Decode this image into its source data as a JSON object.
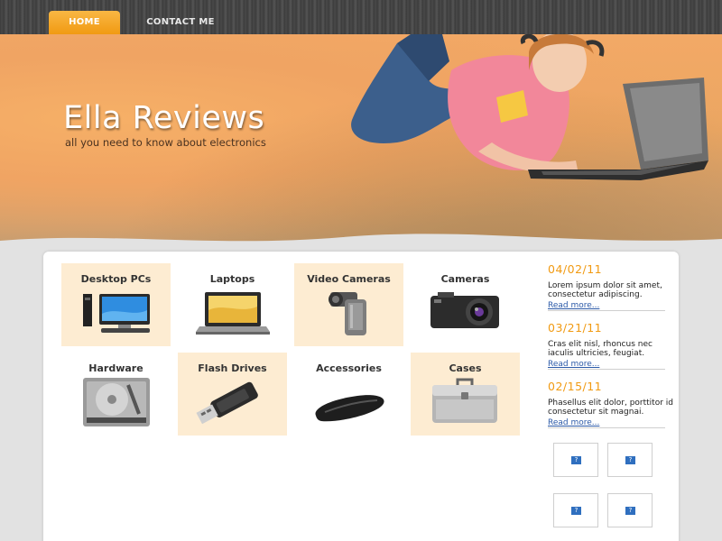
{
  "nav": {
    "home": "HOME",
    "contact": "CONTACT ME"
  },
  "hero": {
    "title": "Ella Reviews",
    "tagline": "all you need to know about electronics"
  },
  "categories": [
    {
      "label": "Desktop PCs",
      "icon": "desktop-pc-icon"
    },
    {
      "label": "Laptops",
      "icon": "laptop-icon"
    },
    {
      "label": "Video Cameras",
      "icon": "video-camera-icon"
    },
    {
      "label": "Cameras",
      "icon": "camera-icon"
    },
    {
      "label": "Hardware",
      "icon": "hard-drive-icon"
    },
    {
      "label": "Flash Drives",
      "icon": "flash-drive-icon"
    },
    {
      "label": "Accessories",
      "icon": "mouse-icon"
    },
    {
      "label": "Cases",
      "icon": "case-icon"
    }
  ],
  "news": [
    {
      "date": "04/02/11",
      "text": "Lorem ipsum dolor sit amet, consectetur adipiscing.",
      "link": "Read more..."
    },
    {
      "date": "03/21/11",
      "text": "Cras elit nisl, rhoncus nec iaculis ultricies, feugiat.",
      "link": "Read more..."
    },
    {
      "date": "02/15/11",
      "text": "Phasellus elit dolor, porttitor id consectetur sit magnai.",
      "link": "Read more..."
    }
  ],
  "thumbs": [
    "?",
    "?",
    "?",
    "?"
  ],
  "colors": {
    "accent": "#f19a12",
    "tile_shade": "#fdecd2",
    "link": "#2c5aa8"
  }
}
